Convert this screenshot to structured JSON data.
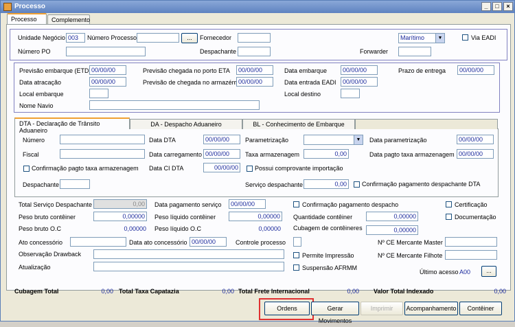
{
  "window": {
    "title": "Processo",
    "minimize": "_",
    "maximize": "□",
    "close": "×"
  },
  "tabs": [
    "Processo",
    "Complemento"
  ],
  "top": {
    "unidade_label": "Unidade Negócio",
    "unidade_value": "003",
    "numero_processo_label": "Número Processo",
    "ellipsis": "...",
    "fornecedor_label": "Fornecedor",
    "modal": "Marítimo",
    "via_eadi": "Via EADI",
    "numero_po_label": "Número PO",
    "despachante_label": "Despachante",
    "forwarder_label": "Forwarder"
  },
  "datas": {
    "prev_emb": "Previsão embarque (ETD)",
    "prev_emb_v": "00/00/00",
    "prev_porto": "Previsão chegada no porto ETA",
    "prev_porto_v": "00/00/00",
    "data_emb": "Data embarque",
    "data_emb_v": "00/00/00",
    "prazo": "Prazo de entrega",
    "prazo_v": "00/00/00",
    "atracacao": "Data atracação",
    "atracacao_v": "00/00/00",
    "prev_armazem": "Previsão de chegada no armazém",
    "prev_armazem_v": "00/00/00",
    "entrada_eadi": "Data entrada EADI",
    "entrada_eadi_v": "00/00/00",
    "local_emb": "Local embarque",
    "local_dest": "Local destino",
    "nome_navio": "Nome Navio"
  },
  "subtabs": [
    "DTA - Declaração de Trânsito Aduaneiro",
    "DA - Despacho Aduaneiro",
    "BL - Conhecimento de Embarque"
  ],
  "dta": {
    "numero": "Número",
    "data_dta": "Data DTA",
    "data_dta_v": "00/00/00",
    "parametrizacao": "Parametrização",
    "data_param": "Data parametrização",
    "data_param_v": "00/00/00",
    "fiscal": "Fiscal",
    "data_carreg": "Data carregamento",
    "data_carreg_v": "00/00/00",
    "taxa_arm": "Taxa armazenagem",
    "taxa_arm_v": "0,00",
    "data_pagto_taxa": "Data pagto taxa armazenagem",
    "data_pagto_taxa_v": "00/00/00",
    "conf_pagto_taxa": "Confirmação pagto taxa armazenagem",
    "data_ci": "Data CI DTA",
    "data_ci_v": "00/00/00",
    "possui_comp": "Possui comprovante importação",
    "despachante": "Despachante",
    "servico_desp": "Serviço despachante",
    "servico_desp_v": "0,00",
    "conf_pagto_desp": "Confirmação pagamento despachante DTA"
  },
  "lower": {
    "total_serv": "Total Serviço Despachante",
    "total_serv_v": "0,00",
    "data_pagto_serv": "Data pagamento serviço",
    "data_pagto_serv_v": "00/00/00",
    "conf_pagto_desp": "Confirmação pagamento despacho",
    "certificacao": "Certificação",
    "peso_bruto_cont": "Peso bruto contêiner",
    "peso_bruto_cont_v": "0,00000",
    "peso_liq_cont": "Peso líquido contêiner",
    "peso_liq_cont_v": "0,00000",
    "qtd_cont": "Quantidade contêiner",
    "qtd_cont_v": "0,00000",
    "documentacao": "Documentação",
    "peso_bruto_oc": "Peso bruto O.C",
    "peso_bruto_oc_v": "0,00000",
    "peso_liq_oc": "Peso líquido O.C",
    "peso_liq_oc_v": "0,00000",
    "cubagem_cont": "Cubagem de contêineres",
    "cubagem_cont_v": "0,00000",
    "ato": "Ato concessório",
    "data_ato": "Data ato concessório",
    "data_ato_v": "00/00/00",
    "controle": "Controle processo",
    "ce_master": "Nº CE Mercante Master",
    "obs_drawback": "Observação Drawback",
    "permite_imp": "Permite Impressão",
    "ce_filhote": "Nº CE Mercante Filhote",
    "atualizacao": "Atualização",
    "suspensao": "Suspensão AFRMM",
    "ultimo_acesso": "Último acesso",
    "ultimo_acesso_v": "A00",
    "ellipsis": "..."
  },
  "totals": {
    "cubagem": "Cubagem Total",
    "cubagem_v": "0,00",
    "taxa_cap": "Total Taxa Capatazia",
    "taxa_cap_v": "0,00",
    "frete": "Total Frete Internacional",
    "frete_v": "0,00",
    "indexado": "Valor Total Indexado",
    "indexado_v": "0,00"
  },
  "buttons": {
    "ordens": "Ordens",
    "gerar": "Gerar Movimentos",
    "imprimir": "Imprimir",
    "acomp": "Acompanhamento",
    "conteiner": "Contêiner"
  },
  "colors": {
    "highlight": "#e03030",
    "value": "#1b2a9c"
  }
}
